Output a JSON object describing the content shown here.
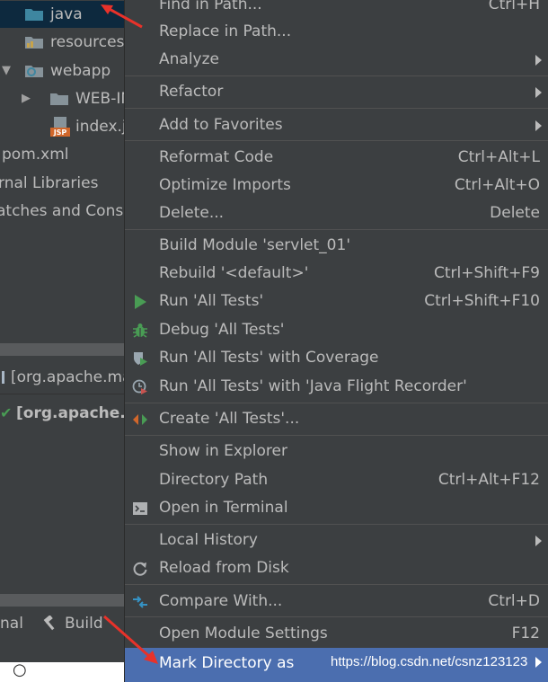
{
  "project_tree": {
    "items": [
      {
        "label": "java",
        "icon": "blue-folder-icon"
      },
      {
        "label": "resources",
        "icon": "resources-folder-icon"
      },
      {
        "label": "webapp",
        "icon": "web-folder-icon"
      },
      {
        "label": "WEB-IN",
        "icon": "folder-icon"
      },
      {
        "label": "index.j",
        "icon": "jsp-file-icon"
      },
      {
        "label": "pom.xml"
      },
      {
        "label": "rnal Libraries"
      },
      {
        "label": "atches and Conso"
      }
    ],
    "console_line_1": "[org.apache.ma",
    "console_line_2": "[org.apache.m",
    "tab_terminal": "nal",
    "tab_build": "Build"
  },
  "menu": {
    "find_in_path": {
      "label": "Find in Path...",
      "shortcut": "Ctrl+H"
    },
    "replace_in_path": {
      "label": "Replace in Path..."
    },
    "analyze": {
      "label": "Analyze"
    },
    "refactor": {
      "label": "Refactor"
    },
    "add_to_favorites": {
      "label": "Add to Favorites"
    },
    "reformat_code": {
      "label": "Reformat Code",
      "shortcut": "Ctrl+Alt+L"
    },
    "optimize_imports": {
      "label": "Optimize Imports",
      "shortcut": "Ctrl+Alt+O"
    },
    "delete": {
      "label": "Delete...",
      "shortcut": "Delete"
    },
    "build_module": {
      "label": "Build Module 'servlet_01'"
    },
    "rebuild": {
      "label": "Rebuild '<default>'",
      "shortcut": "Ctrl+Shift+F9"
    },
    "run_all_tests": {
      "label": "Run 'All Tests'",
      "shortcut": "Ctrl+Shift+F10"
    },
    "debug_all_tests": {
      "label": "Debug 'All Tests'"
    },
    "run_with_coverage": {
      "label": "Run 'All Tests' with Coverage"
    },
    "run_with_jfr": {
      "label": "Run 'All Tests' with 'Java Flight Recorder'"
    },
    "create_all_tests": {
      "label": "Create 'All Tests'..."
    },
    "show_in_explorer": {
      "label": "Show in Explorer"
    },
    "directory_path": {
      "label": "Directory Path",
      "shortcut": "Ctrl+Alt+F12"
    },
    "open_in_terminal": {
      "label": "Open in Terminal"
    },
    "local_history": {
      "label": "Local History"
    },
    "reload_from_disk": {
      "label": "Reload from Disk"
    },
    "compare_with": {
      "label": "Compare With...",
      "shortcut": "Ctrl+D"
    },
    "open_module_settings": {
      "label": "Open Module Settings",
      "shortcut": "F12"
    },
    "mark_directory_as": {
      "label": "Mark Directory as"
    }
  },
  "watermark": "https://blog.csdn.net/csnz123123",
  "colors": {
    "menu_bg": "#3c3f41",
    "highlight": "#4b6eaf",
    "annotation_red": "#e8322a",
    "run_green": "#499c54",
    "selection_blue": "#0d293e"
  }
}
